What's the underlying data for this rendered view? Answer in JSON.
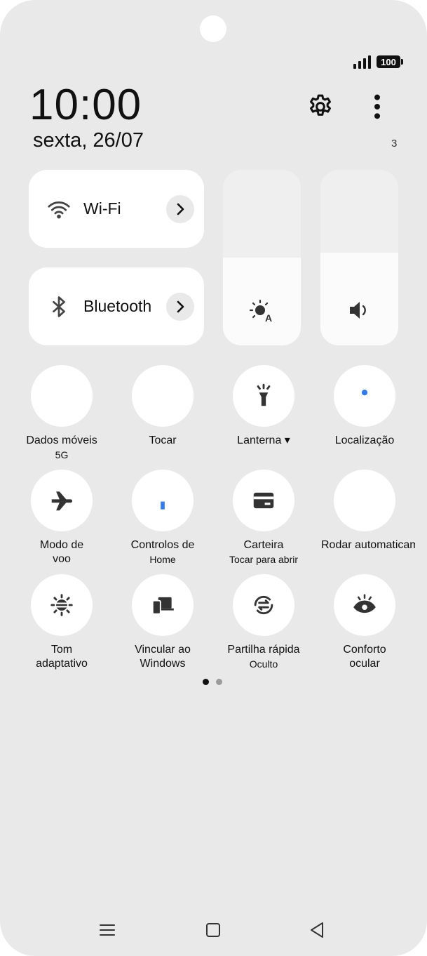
{
  "status": {
    "battery": "100",
    "signal_bars": 4
  },
  "header": {
    "time": "10:00",
    "date": "sexta, 26/07",
    "notification_count": "3"
  },
  "tiles": [
    {
      "label": "Wi-Fi",
      "icon": "wifi-icon"
    },
    {
      "label": "Bluetooth",
      "icon": "bluetooth-icon"
    }
  ],
  "sliders": {
    "brightness_level": 0.5,
    "volume_level": 0.53
  },
  "quick_settings": [
    {
      "label": "Dados móveis",
      "sub": "5G",
      "active": true,
      "icon": "mobile-data-icon"
    },
    {
      "label": "Tocar",
      "sub": "",
      "active": true,
      "icon": "bell-icon"
    },
    {
      "label": "Lanterna ▾",
      "sub": "",
      "active": false,
      "icon": "flashlight-icon"
    },
    {
      "label": "Localização",
      "sub": "",
      "active": true,
      "icon": "location-icon"
    },
    {
      "label": "Modo de\nvoo",
      "sub": "",
      "active": false,
      "icon": "airplane-icon"
    },
    {
      "label": "Controlos de",
      "sub": "Home",
      "active": true,
      "icon": "home-icon"
    },
    {
      "label": "Carteira",
      "sub": "Tocar para abrir",
      "active": false,
      "icon": "wallet-icon"
    },
    {
      "label": "Rodar automaticamente",
      "sub": "",
      "active": true,
      "icon": "auto-rotate-icon"
    },
    {
      "label": "Tom\nadaptativo",
      "sub": "",
      "active": false,
      "icon": "adaptive-tone-icon"
    },
    {
      "label": "Vincular ao\nWindows",
      "sub": "",
      "active": false,
      "icon": "link-windows-icon"
    },
    {
      "label": "Partilha rápida",
      "sub": "Oculto",
      "active": false,
      "icon": "quick-share-icon"
    },
    {
      "label": "Conforto\nocular",
      "sub": "",
      "active": false,
      "icon": "eye-comfort-icon"
    }
  ],
  "pagination": {
    "pages": 2,
    "current": 1
  },
  "colors": {
    "accent": "#2f7bf5",
    "background": "#e9e9e9"
  }
}
